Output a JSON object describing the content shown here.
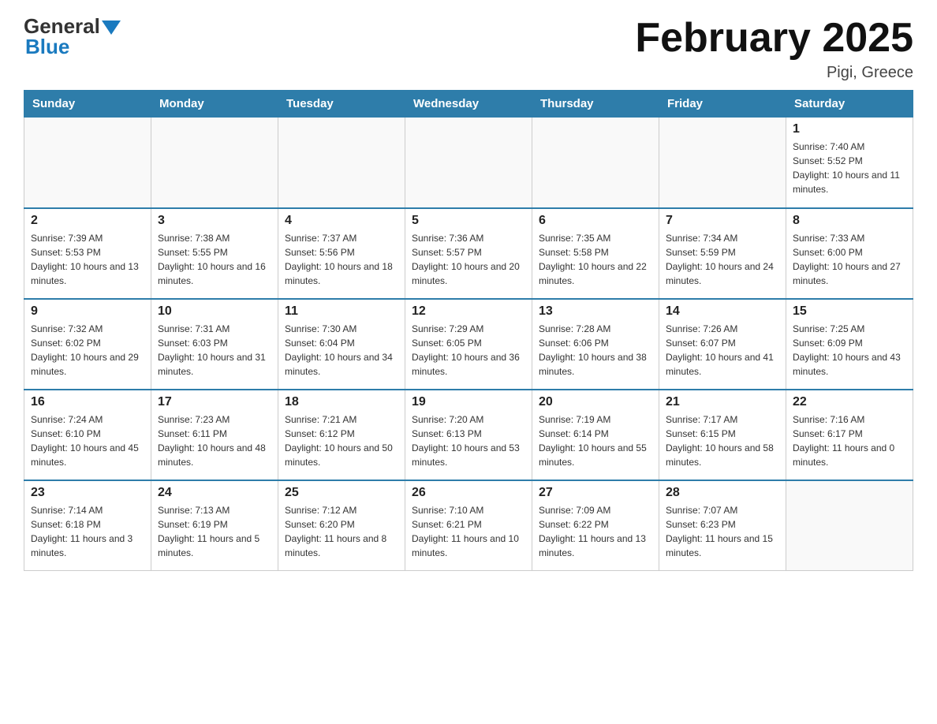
{
  "header": {
    "logo_text_general": "General",
    "logo_text_blue": "Blue",
    "month_title": "February 2025",
    "location": "Pigi, Greece"
  },
  "weekdays": [
    "Sunday",
    "Monday",
    "Tuesday",
    "Wednesday",
    "Thursday",
    "Friday",
    "Saturday"
  ],
  "weeks": [
    [
      {
        "day": "",
        "sunrise": "",
        "sunset": "",
        "daylight": ""
      },
      {
        "day": "",
        "sunrise": "",
        "sunset": "",
        "daylight": ""
      },
      {
        "day": "",
        "sunrise": "",
        "sunset": "",
        "daylight": ""
      },
      {
        "day": "",
        "sunrise": "",
        "sunset": "",
        "daylight": ""
      },
      {
        "day": "",
        "sunrise": "",
        "sunset": "",
        "daylight": ""
      },
      {
        "day": "",
        "sunrise": "",
        "sunset": "",
        "daylight": ""
      },
      {
        "day": "1",
        "sunrise": "Sunrise: 7:40 AM",
        "sunset": "Sunset: 5:52 PM",
        "daylight": "Daylight: 10 hours and 11 minutes."
      }
    ],
    [
      {
        "day": "2",
        "sunrise": "Sunrise: 7:39 AM",
        "sunset": "Sunset: 5:53 PM",
        "daylight": "Daylight: 10 hours and 13 minutes."
      },
      {
        "day": "3",
        "sunrise": "Sunrise: 7:38 AM",
        "sunset": "Sunset: 5:55 PM",
        "daylight": "Daylight: 10 hours and 16 minutes."
      },
      {
        "day": "4",
        "sunrise": "Sunrise: 7:37 AM",
        "sunset": "Sunset: 5:56 PM",
        "daylight": "Daylight: 10 hours and 18 minutes."
      },
      {
        "day": "5",
        "sunrise": "Sunrise: 7:36 AM",
        "sunset": "Sunset: 5:57 PM",
        "daylight": "Daylight: 10 hours and 20 minutes."
      },
      {
        "day": "6",
        "sunrise": "Sunrise: 7:35 AM",
        "sunset": "Sunset: 5:58 PM",
        "daylight": "Daylight: 10 hours and 22 minutes."
      },
      {
        "day": "7",
        "sunrise": "Sunrise: 7:34 AM",
        "sunset": "Sunset: 5:59 PM",
        "daylight": "Daylight: 10 hours and 24 minutes."
      },
      {
        "day": "8",
        "sunrise": "Sunrise: 7:33 AM",
        "sunset": "Sunset: 6:00 PM",
        "daylight": "Daylight: 10 hours and 27 minutes."
      }
    ],
    [
      {
        "day": "9",
        "sunrise": "Sunrise: 7:32 AM",
        "sunset": "Sunset: 6:02 PM",
        "daylight": "Daylight: 10 hours and 29 minutes."
      },
      {
        "day": "10",
        "sunrise": "Sunrise: 7:31 AM",
        "sunset": "Sunset: 6:03 PM",
        "daylight": "Daylight: 10 hours and 31 minutes."
      },
      {
        "day": "11",
        "sunrise": "Sunrise: 7:30 AM",
        "sunset": "Sunset: 6:04 PM",
        "daylight": "Daylight: 10 hours and 34 minutes."
      },
      {
        "day": "12",
        "sunrise": "Sunrise: 7:29 AM",
        "sunset": "Sunset: 6:05 PM",
        "daylight": "Daylight: 10 hours and 36 minutes."
      },
      {
        "day": "13",
        "sunrise": "Sunrise: 7:28 AM",
        "sunset": "Sunset: 6:06 PM",
        "daylight": "Daylight: 10 hours and 38 minutes."
      },
      {
        "day": "14",
        "sunrise": "Sunrise: 7:26 AM",
        "sunset": "Sunset: 6:07 PM",
        "daylight": "Daylight: 10 hours and 41 minutes."
      },
      {
        "day": "15",
        "sunrise": "Sunrise: 7:25 AM",
        "sunset": "Sunset: 6:09 PM",
        "daylight": "Daylight: 10 hours and 43 minutes."
      }
    ],
    [
      {
        "day": "16",
        "sunrise": "Sunrise: 7:24 AM",
        "sunset": "Sunset: 6:10 PM",
        "daylight": "Daylight: 10 hours and 45 minutes."
      },
      {
        "day": "17",
        "sunrise": "Sunrise: 7:23 AM",
        "sunset": "Sunset: 6:11 PM",
        "daylight": "Daylight: 10 hours and 48 minutes."
      },
      {
        "day": "18",
        "sunrise": "Sunrise: 7:21 AM",
        "sunset": "Sunset: 6:12 PM",
        "daylight": "Daylight: 10 hours and 50 minutes."
      },
      {
        "day": "19",
        "sunrise": "Sunrise: 7:20 AM",
        "sunset": "Sunset: 6:13 PM",
        "daylight": "Daylight: 10 hours and 53 minutes."
      },
      {
        "day": "20",
        "sunrise": "Sunrise: 7:19 AM",
        "sunset": "Sunset: 6:14 PM",
        "daylight": "Daylight: 10 hours and 55 minutes."
      },
      {
        "day": "21",
        "sunrise": "Sunrise: 7:17 AM",
        "sunset": "Sunset: 6:15 PM",
        "daylight": "Daylight: 10 hours and 58 minutes."
      },
      {
        "day": "22",
        "sunrise": "Sunrise: 7:16 AM",
        "sunset": "Sunset: 6:17 PM",
        "daylight": "Daylight: 11 hours and 0 minutes."
      }
    ],
    [
      {
        "day": "23",
        "sunrise": "Sunrise: 7:14 AM",
        "sunset": "Sunset: 6:18 PM",
        "daylight": "Daylight: 11 hours and 3 minutes."
      },
      {
        "day": "24",
        "sunrise": "Sunrise: 7:13 AM",
        "sunset": "Sunset: 6:19 PM",
        "daylight": "Daylight: 11 hours and 5 minutes."
      },
      {
        "day": "25",
        "sunrise": "Sunrise: 7:12 AM",
        "sunset": "Sunset: 6:20 PM",
        "daylight": "Daylight: 11 hours and 8 minutes."
      },
      {
        "day": "26",
        "sunrise": "Sunrise: 7:10 AM",
        "sunset": "Sunset: 6:21 PM",
        "daylight": "Daylight: 11 hours and 10 minutes."
      },
      {
        "day": "27",
        "sunrise": "Sunrise: 7:09 AM",
        "sunset": "Sunset: 6:22 PM",
        "daylight": "Daylight: 11 hours and 13 minutes."
      },
      {
        "day": "28",
        "sunrise": "Sunrise: 7:07 AM",
        "sunset": "Sunset: 6:23 PM",
        "daylight": "Daylight: 11 hours and 15 minutes."
      },
      {
        "day": "",
        "sunrise": "",
        "sunset": "",
        "daylight": ""
      }
    ]
  ]
}
